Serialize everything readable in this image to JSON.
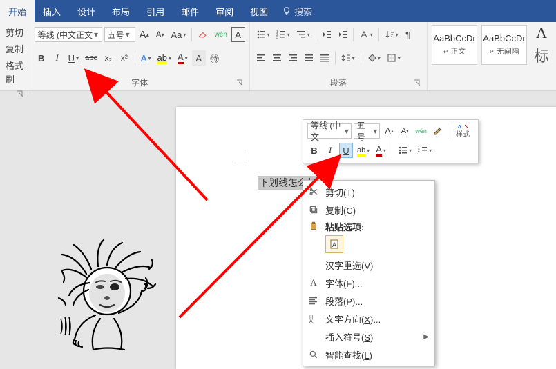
{
  "tabs": {
    "items": [
      "开始",
      "插入",
      "设计",
      "布局",
      "引用",
      "邮件",
      "审阅",
      "视图"
    ],
    "active_index": 0,
    "search_placeholder": "搜索"
  },
  "clipboard": {
    "cut": "剪切",
    "copy": "复制",
    "format_painter": "格式刷"
  },
  "font": {
    "name": "等线 (中文正文",
    "size": "五号",
    "grow_label": "A",
    "shrink_label": "A",
    "change_case": "Aa",
    "phonetic": "wén",
    "char_border": "A",
    "bold": "B",
    "italic": "I",
    "underline": "U",
    "strike": "abc",
    "subscript": "x₂",
    "superscript": "x²",
    "text_effect": "A",
    "highlight": "A",
    "font_color": "A",
    "char_shading": "A",
    "enclose": "㊕",
    "group_label": "字体"
  },
  "paragraph": {
    "group_label": "段落"
  },
  "styles": {
    "preview_text": "AaBbCcDr",
    "item1": "正文",
    "item2": "无间隔",
    "item3_trunc": "标"
  },
  "mini": {
    "font_name": "等线 (中文",
    "font_size": "五号",
    "styles_label": "样式"
  },
  "context_menu": {
    "cut": "剪切",
    "cut_accel": "T",
    "copy": "复制",
    "copy_accel": "C",
    "paste_options": "粘贴选项:",
    "cn_reselect": "汉字重选",
    "cn_reselect_accel": "V",
    "font": "字体",
    "font_accel": "F",
    "paragraph": "段落",
    "paragraph_accel": "P",
    "text_direction": "文字方向",
    "text_direction_accel": "X",
    "insert_symbol": "插入符号",
    "insert_symbol_accel": "S",
    "smart_lookup": "智能查找",
    "smart_lookup_accel": "L"
  },
  "document": {
    "typed_text": "下划线怎么打"
  },
  "colors": {
    "highlight": "#ffff00",
    "underline_accent": "#1f6dd0",
    "font_color": "#c00000",
    "ribbon_blue": "#2b579a"
  }
}
